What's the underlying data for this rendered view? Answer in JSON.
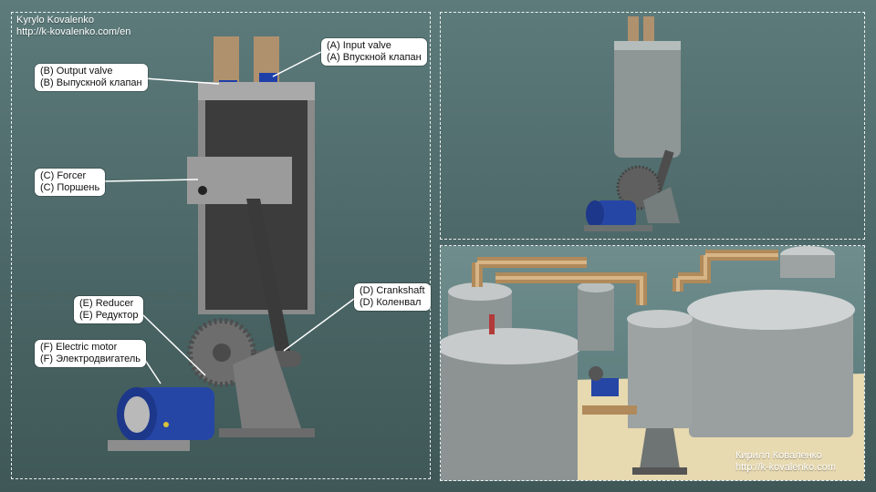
{
  "credits": {
    "top_left": [
      "Kyrylo Kovalenko",
      "http://k-kovalenko.com/en"
    ],
    "bottom_right": [
      "Кирилл Коваленко",
      "http://k-kovalenko.com"
    ]
  },
  "labels": {
    "A": [
      "(A) Input valve",
      "(A) Впускной клапан"
    ],
    "B": [
      "(B) Output valve",
      "(B) Выпускной клапан"
    ],
    "C": [
      "(C) Forcer",
      "(C) Поршень"
    ],
    "D": [
      "(D) Crankshaft",
      "(D) Коленвал"
    ],
    "E": [
      "(E) Reducer",
      "(E) Редуктор"
    ],
    "F": [
      "(F) Electric motor",
      "(F) Электродвигатель"
    ]
  },
  "colors": {
    "background": "#4f6b6b",
    "cylinder": "#8c8c8c",
    "pipe_copper": "#b08a5a",
    "motor_blue": "#2646a6",
    "valve_blue": "#1f3fa8",
    "floor": "#e7d9b0"
  }
}
